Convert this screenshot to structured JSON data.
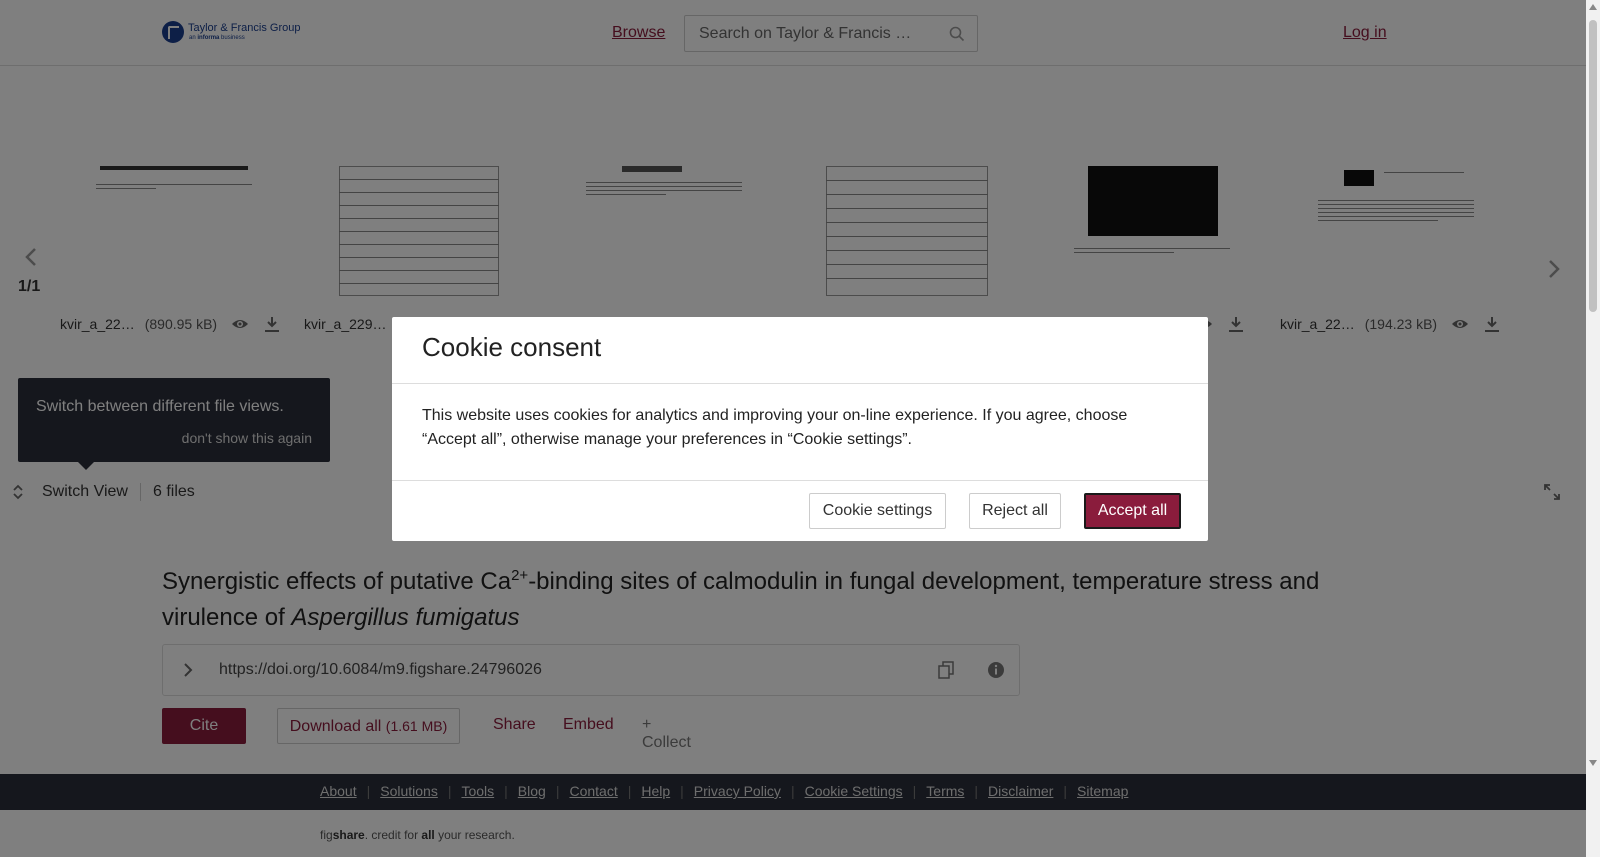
{
  "header": {
    "logo_title": "Taylor & Francis Group",
    "logo_sub_prefix": "an",
    "logo_sub_brand": "informa",
    "logo_sub_suffix": "business",
    "browse_label": "Browse",
    "search_placeholder": "Search on Taylor & Francis …",
    "login_label": "Log in"
  },
  "carousel": {
    "counter": "1/1",
    "files": [
      {
        "name": "kvir_a_22…",
        "size": "(890.95 kB)"
      },
      {
        "name": "kvir_a_229…",
        "size": ""
      },
      {
        "name": "",
        "size": ""
      },
      {
        "name": "",
        "size": ""
      },
      {
        "name": "",
        "size": ""
      },
      {
        "name": "kvir_a_22…",
        "size": "(194.23 kB)"
      }
    ]
  },
  "tooltip": {
    "text": "Switch between different file views.",
    "dismiss": "don't show this again"
  },
  "switchbar": {
    "label": "Switch View",
    "files_count": "6 files"
  },
  "article": {
    "title_part1": "Synergistic effects of putative Ca",
    "title_sup": "2+",
    "title_part2": "-binding sites of calmodulin in fungal development, temperature stress and virulence of ",
    "title_italic": "Aspergillus fumigatus",
    "doi": "https://doi.org/10.6084/m9.figshare.24796026"
  },
  "actions": {
    "cite": "Cite",
    "download_all": "Download all",
    "download_size": "(1.61 MB)",
    "share": "Share",
    "embed": "Embed",
    "collect": "+ Collect"
  },
  "footer": {
    "links": [
      "About",
      "Solutions",
      "Tools",
      "Blog",
      "Contact",
      "Help",
      "Privacy Policy",
      "Cookie Settings",
      "Terms",
      "Disclaimer",
      "Sitemap"
    ],
    "credit_fig": "fig",
    "credit_share": "share",
    "credit_mid": ". credit for ",
    "credit_all": "all",
    "credit_end": " your research."
  },
  "cookie_modal": {
    "title": "Cookie consent",
    "body": "This website uses cookies for analytics and improving your on-line experience. If you agree, choose “Accept all”, otherwise manage your preferences in “Cookie settings”.",
    "settings_button": "Cookie settings",
    "reject_button": "Reject all",
    "accept_button": "Accept all"
  },
  "colors": {
    "brand": "#8a1c3c",
    "footer_bg": "#2b2f3a",
    "overlay": "rgba(0,0,0,0.5)"
  }
}
